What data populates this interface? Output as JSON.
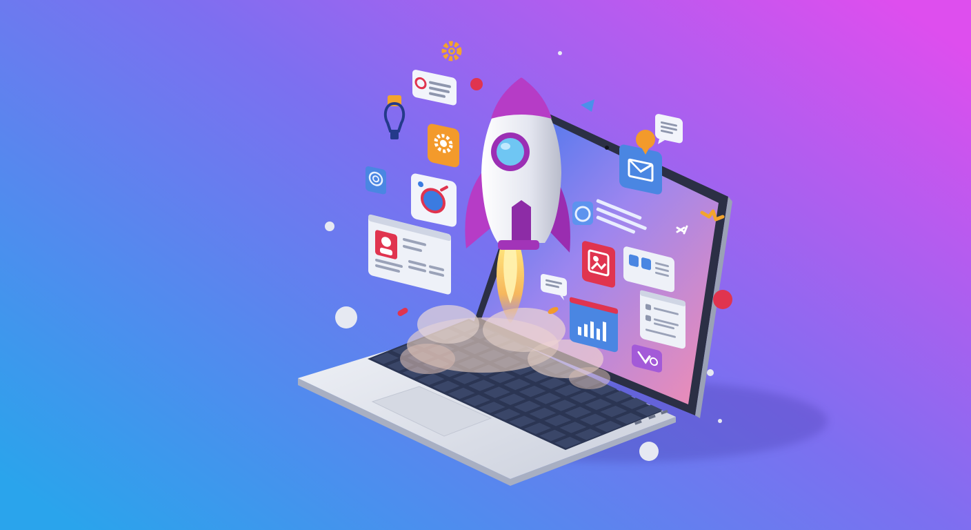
{
  "palette": {
    "bg_left": "#2aa4ec",
    "bg_mid": "#7d6ff0",
    "bg_right": "#de4eee",
    "laptop_body": "#e3e6ee",
    "laptop_shade": "#b7bdcc",
    "key_dark": "#2b3553",
    "screen_blue": "#4f86ee",
    "screen_pink": "#f08ab4",
    "rocket_white": "#eceef6",
    "rocket_purple": "#b63cc6",
    "window_blue": "#4a86e2",
    "accent_orange": "#f39a2b",
    "accent_red": "#e0344f",
    "accent_purple": "#a35ad8",
    "flame_yellow": "#f7d253",
    "smoke_peach": "#f4d7c4"
  },
  "objects": {
    "laptop": "laptop-illustration",
    "rocket": "rocket-illustration",
    "icons": [
      "gear-icon",
      "settings-tile-icon",
      "lightbulb-icon",
      "copyright-tile-icon",
      "target-tile-icon",
      "mail-tile-icon",
      "chat-bubble-icon",
      "profile-card-icon",
      "bar-chart-window-icon",
      "image-gallery-icon",
      "social-card-icon",
      "checklist-window-icon",
      "send-tile-icon",
      "triangle-icon",
      "location-pin-icon"
    ]
  }
}
